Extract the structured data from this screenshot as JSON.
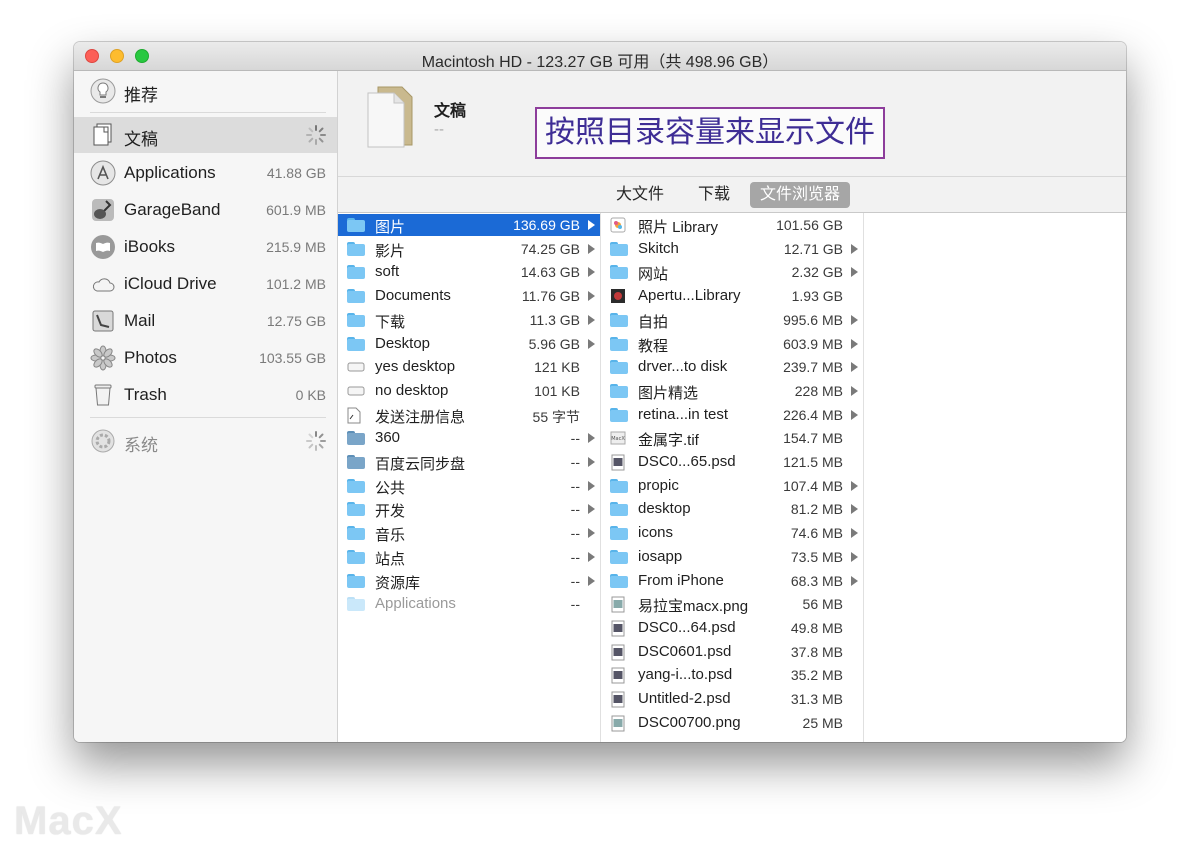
{
  "window": {
    "title": "Macintosh HD - 123.27 GB 可用（共 498.96 GB）"
  },
  "sidebar": {
    "top": {
      "label": "推荐",
      "icon": "lightbulb-icon"
    },
    "items": [
      {
        "label": "文稿",
        "size": "",
        "icon": "documents-icon",
        "loading": true
      },
      {
        "label": "Applications",
        "size": "41.88 GB",
        "icon": "app-store-icon"
      },
      {
        "label": "GarageBand",
        "size": "601.9 MB",
        "icon": "guitar-icon"
      },
      {
        "label": "iBooks",
        "size": "215.9 MB",
        "icon": "ibooks-icon"
      },
      {
        "label": "iCloud Drive",
        "size": "101.2 MB",
        "icon": "cloud-icon"
      },
      {
        "label": "Mail",
        "size": "12.75 GB",
        "icon": "mail-icon"
      },
      {
        "label": "Photos",
        "size": "103.55 GB",
        "icon": "photos-icon"
      },
      {
        "label": "Trash",
        "size": "0 KB",
        "icon": "trash-icon"
      }
    ],
    "system": {
      "label": "系统",
      "icon": "system-gear-icon"
    }
  },
  "header": {
    "title": "文稿",
    "subtitle": "--",
    "annotation": "按照目录容量来显示文件"
  },
  "tabs": [
    {
      "label": "大文件"
    },
    {
      "label": "下载"
    },
    {
      "label": "文件浏览器",
      "selected": true
    }
  ],
  "column1": [
    {
      "name": "图片",
      "size": "136.69 GB",
      "arrow": true,
      "selected": true,
      "icon": "folder-pictures-icon"
    },
    {
      "name": "影片",
      "size": "74.25 GB",
      "arrow": true,
      "icon": "folder-movies-icon"
    },
    {
      "name": "soft",
      "size": "14.63 GB",
      "arrow": true,
      "icon": "folder-icon"
    },
    {
      "name": "Documents",
      "size": "11.76 GB",
      "arrow": true,
      "icon": "folder-documents-icon"
    },
    {
      "name": "下载",
      "size": "11.3 GB",
      "arrow": true,
      "icon": "folder-downloads-icon"
    },
    {
      "name": "Desktop",
      "size": "5.96 GB",
      "arrow": true,
      "icon": "folder-desktop-icon"
    },
    {
      "name": "yes desktop",
      "size": "121 KB",
      "arrow": false,
      "icon": "alias-icon"
    },
    {
      "name": "no desktop",
      "size": "101 KB",
      "arrow": false,
      "icon": "alias-icon"
    },
    {
      "name": "发送注册信息",
      "size": "55 字节",
      "arrow": false,
      "icon": "file-icon"
    },
    {
      "name": "360",
      "size": "--",
      "arrow": true,
      "icon": "folder-dark-icon"
    },
    {
      "name": "百度云同步盘",
      "size": "--",
      "arrow": true,
      "icon": "folder-sync-icon"
    },
    {
      "name": "公共",
      "size": "--",
      "arrow": true,
      "icon": "folder-public-icon"
    },
    {
      "name": "开发",
      "size": "--",
      "arrow": true,
      "icon": "folder-icon"
    },
    {
      "name": "音乐",
      "size": "--",
      "arrow": true,
      "icon": "folder-music-icon"
    },
    {
      "name": "站点",
      "size": "--",
      "arrow": true,
      "icon": "folder-sites-icon"
    },
    {
      "name": "资源库",
      "size": "--",
      "arrow": true,
      "icon": "folder-library-icon"
    },
    {
      "name": "Applications",
      "size": "--",
      "arrow": false,
      "dim": true,
      "icon": "folder-applications-icon"
    }
  ],
  "column2": [
    {
      "name": "照片 Library",
      "size": "101.56 GB",
      "arrow": false,
      "icon": "photos-library-icon"
    },
    {
      "name": "Skitch",
      "size": "12.71 GB",
      "arrow": true,
      "icon": "folder-icon"
    },
    {
      "name": "网站",
      "size": "2.32 GB",
      "arrow": true,
      "icon": "folder-icon"
    },
    {
      "name": "Apertu...Library",
      "size": "1.93 GB",
      "arrow": false,
      "icon": "aperture-library-icon"
    },
    {
      "name": "自拍",
      "size": "995.6 MB",
      "arrow": true,
      "icon": "folder-icon"
    },
    {
      "name": "教程",
      "size": "603.9 MB",
      "arrow": true,
      "icon": "folder-icon"
    },
    {
      "name": "drver...to disk",
      "size": "239.7 MB",
      "arrow": true,
      "icon": "folder-icon"
    },
    {
      "name": "图片精选",
      "size": "228 MB",
      "arrow": true,
      "icon": "folder-icon"
    },
    {
      "name": "retina...in test",
      "size": "226.4 MB",
      "arrow": true,
      "icon": "folder-icon"
    },
    {
      "name": "金属字.tif",
      "size": "154.7 MB",
      "arrow": false,
      "icon": "tif-image-icon"
    },
    {
      "name": "DSC0...65.psd",
      "size": "121.5 MB",
      "arrow": false,
      "icon": "psd-image-icon"
    },
    {
      "name": "propic",
      "size": "107.4 MB",
      "arrow": true,
      "icon": "folder-icon"
    },
    {
      "name": "desktop",
      "size": "81.2 MB",
      "arrow": true,
      "icon": "folder-icon"
    },
    {
      "name": "icons",
      "size": "74.6 MB",
      "arrow": true,
      "icon": "folder-icon"
    },
    {
      "name": "iosapp",
      "size": "73.5 MB",
      "arrow": true,
      "icon": "folder-icon"
    },
    {
      "name": "From iPhone",
      "size": "68.3 MB",
      "arrow": true,
      "icon": "folder-icon"
    },
    {
      "name": "易拉宝macx.png",
      "size": "56 MB",
      "arrow": false,
      "icon": "png-image-icon"
    },
    {
      "name": "DSC0...64.psd",
      "size": "49.8 MB",
      "arrow": false,
      "icon": "psd-image-icon"
    },
    {
      "name": "DSC0601.psd",
      "size": "37.8 MB",
      "arrow": false,
      "icon": "psd-image-icon"
    },
    {
      "name": "yang-i...to.psd",
      "size": "35.2 MB",
      "arrow": false,
      "icon": "psd-image-icon"
    },
    {
      "name": "Untitled-2.psd",
      "size": "31.3 MB",
      "arrow": false,
      "icon": "psd-image-icon"
    },
    {
      "name": "DSC00700.png",
      "size": "25 MB",
      "arrow": false,
      "icon": "png-image-icon"
    }
  ],
  "watermark": "MacX",
  "colors": {
    "selection": "#1b6ad6",
    "annotation_border": "#8d3d9b",
    "annotation_text": "#3e2d95"
  }
}
